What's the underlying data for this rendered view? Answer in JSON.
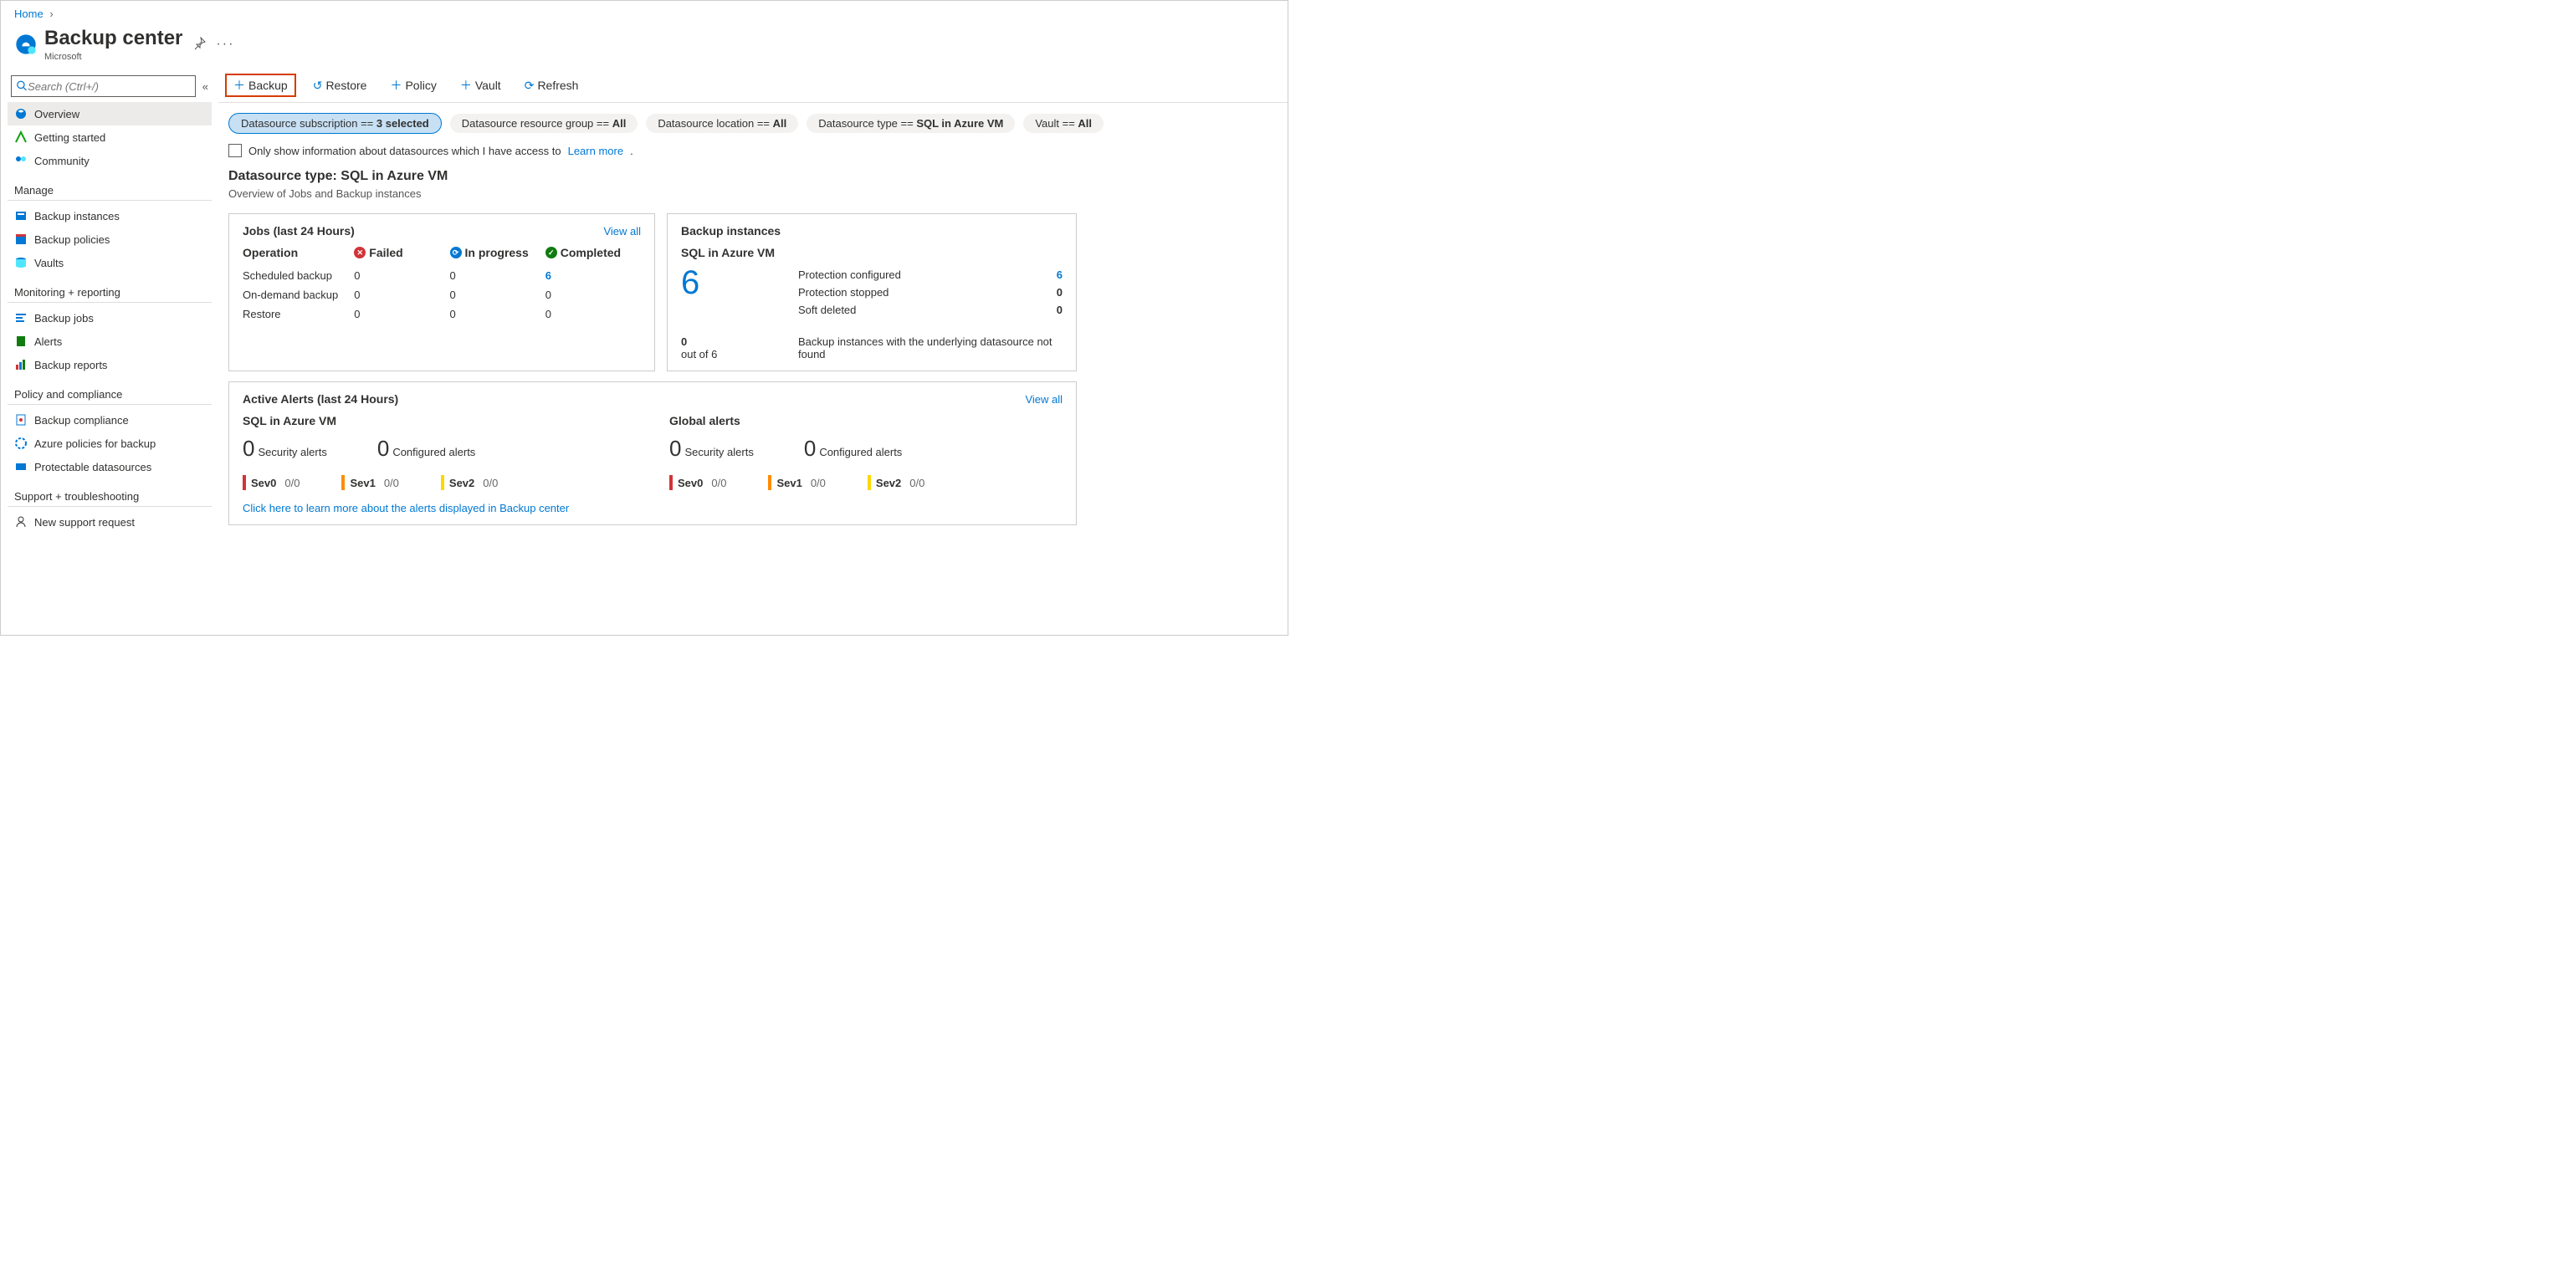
{
  "breadcrumb": {
    "home": "Home"
  },
  "header": {
    "title": "Backup center",
    "subtitle": "Microsoft"
  },
  "search": {
    "placeholder": "Search (Ctrl+/)"
  },
  "sidebar": {
    "items": [
      {
        "label": "Overview"
      },
      {
        "label": "Getting started"
      },
      {
        "label": "Community"
      }
    ],
    "sections": {
      "manage": {
        "title": "Manage",
        "items": [
          {
            "label": "Backup instances"
          },
          {
            "label": "Backup policies"
          },
          {
            "label": "Vaults"
          }
        ]
      },
      "monitoring": {
        "title": "Monitoring + reporting",
        "items": [
          {
            "label": "Backup jobs"
          },
          {
            "label": "Alerts"
          },
          {
            "label": "Backup reports"
          }
        ]
      },
      "policy": {
        "title": "Policy and compliance",
        "items": [
          {
            "label": "Backup compliance"
          },
          {
            "label": "Azure policies for backup"
          },
          {
            "label": "Protectable datasources"
          }
        ]
      },
      "support": {
        "title": "Support + troubleshooting",
        "items": [
          {
            "label": "New support request"
          }
        ]
      }
    }
  },
  "toolbar": {
    "backup": "Backup",
    "restore": "Restore",
    "policy": "Policy",
    "vault": "Vault",
    "refresh": "Refresh"
  },
  "filters": {
    "subscription": {
      "label": "Datasource subscription == ",
      "value": "3 selected"
    },
    "resourcegroup": {
      "label": "Datasource resource group == ",
      "value": "All"
    },
    "location": {
      "label": "Datasource location == ",
      "value": "All"
    },
    "type": {
      "label": "Datasource type == ",
      "value": "SQL in Azure VM"
    },
    "vault": {
      "label": "Vault == ",
      "value": "All"
    }
  },
  "checkboxRow": {
    "text": "Only show information about datasources which I have access to ",
    "link": "Learn more"
  },
  "section": {
    "title": "Datasource type: SQL in Azure VM",
    "subtitle": "Overview of Jobs and Backup instances"
  },
  "jobs": {
    "title": "Jobs (last 24 Hours)",
    "viewAll": "View all",
    "headers": {
      "operation": "Operation",
      "failed": "Failed",
      "inprogress": "In progress",
      "completed": "Completed"
    },
    "rows": [
      {
        "label": "Scheduled backup",
        "failed": "0",
        "inprogress": "0",
        "completed": "6"
      },
      {
        "label": "On-demand backup",
        "failed": "0",
        "inprogress": "0",
        "completed": "0"
      },
      {
        "label": "Restore",
        "failed": "0",
        "inprogress": "0",
        "completed": "0"
      }
    ]
  },
  "instances": {
    "title": "Backup instances",
    "subtitle": "SQL in Azure VM",
    "bigNumber": "6",
    "rows": [
      {
        "label": "Protection configured",
        "value": "6"
      },
      {
        "label": "Protection stopped",
        "value": "0"
      },
      {
        "label": "Soft deleted",
        "value": "0"
      }
    ],
    "bottom": {
      "count": "0",
      "sub": "out of 6",
      "text": "Backup instances with the underlying datasource not found"
    }
  },
  "alerts": {
    "title": "Active Alerts (last 24 Hours)",
    "viewAll": "View all",
    "left": {
      "subtitle": "SQL in Azure VM",
      "security": {
        "n": "0",
        "label": "Security alerts"
      },
      "configured": {
        "n": "0",
        "label": "Configured alerts"
      },
      "sev0": {
        "label": "Sev0",
        "value": "0/0"
      },
      "sev1": {
        "label": "Sev1",
        "value": "0/0"
      },
      "sev2": {
        "label": "Sev2",
        "value": "0/0"
      }
    },
    "right": {
      "subtitle": "Global alerts",
      "security": {
        "n": "0",
        "label": "Security alerts"
      },
      "configured": {
        "n": "0",
        "label": "Configured alerts"
      },
      "sev0": {
        "label": "Sev0",
        "value": "0/0"
      },
      "sev1": {
        "label": "Sev1",
        "value": "0/0"
      },
      "sev2": {
        "label": "Sev2",
        "value": "0/0"
      }
    },
    "link": "Click here to learn more about the alerts displayed in Backup center"
  }
}
